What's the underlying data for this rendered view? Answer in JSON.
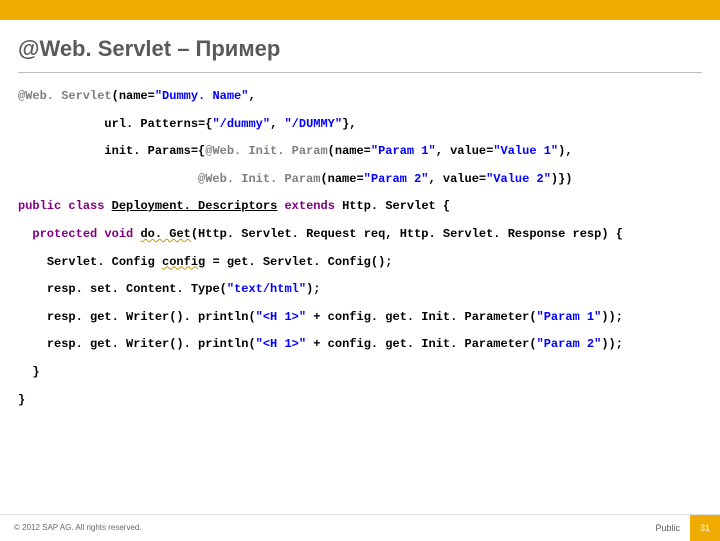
{
  "slide": {
    "title": "@Web. Servlet – Пример"
  },
  "code": {
    "ann": "@Web. Servlet",
    "name_label": "(name=",
    "name_value": "\"Dummy. Name\"",
    "comma": ",",
    "url_label": "url. Patterns={",
    "url_val1": "\"/dummy\"",
    "url_sep": ", ",
    "url_val2": "\"/DUMMY\"",
    "url_close": "},",
    "init_label": "init. Params={",
    "initparam_ann": "@Web. Init. Param",
    "ip_name_open": "(name=",
    "ip_name1": "\"Param 1\"",
    "ip_val_open": ", value=",
    "ip_value1": "\"Value 1\"",
    "ip_close1": "),",
    "ip_name2": "\"Param 2\"",
    "ip_value2": "\"Value 2\"",
    "ip_close2": ")})",
    "kw_public": "public",
    "kw_class": "class",
    "cls_name": "Deployment. Descriptors",
    "kw_extends": "extends",
    "supertype": "Http. Servlet {",
    "kw_protected": "protected",
    "kw_void": "void",
    "method_name": "do. Get",
    "method_sig": "(Http. Servlet. Request req, Http. Servlet. Response resp) {",
    "line_cfg_a": "Servlet. Config ",
    "line_cfg_var": "config",
    "line_cfg_b": " = get. Servlet. Config();",
    "line_ct_a": "resp. set. Content. Type(",
    "line_ct_str": "\"text/html\"",
    "line_ct_b": ");",
    "line_w1_a": "resp. get. Writer(). println(",
    "line_w_str": "\"<H 1>\"",
    "line_w1_b": " + config. get. Init. Parameter(",
    "line_w1_p": "\"Param 1\"",
    "line_w1_c": "));",
    "line_w2_a": "resp. get. Writer(). println(",
    "line_w2_b": " + config. get. Init. Parameter(",
    "line_w2_p": "\"Param 2\"",
    "line_w2_c": "));",
    "brace1": "}",
    "brace2": "}"
  },
  "footer": {
    "copyright": "© 2012 SAP AG. All rights reserved.",
    "classification": "Public",
    "page_number": "31"
  }
}
